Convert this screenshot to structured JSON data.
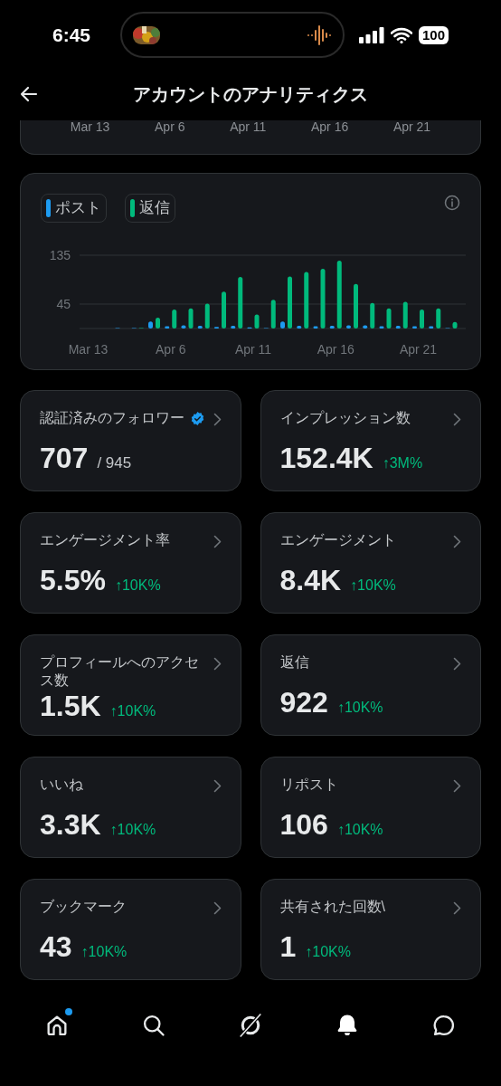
{
  "status_bar": {
    "time": "6:45",
    "battery": "100"
  },
  "header": {
    "title": "アカウントのアナリティクス"
  },
  "previous_chart": {
    "axis_labels": [
      "Mar 13",
      "Apr 6",
      "Apr 11",
      "Apr 16",
      "Apr 21"
    ]
  },
  "chart_card": {
    "chart_data": {
      "type": "bar",
      "categories": [
        "Mar 13",
        null,
        null,
        null,
        null,
        "Apr 6",
        null,
        null,
        null,
        null,
        "Apr 11",
        null,
        null,
        null,
        null,
        "Apr 16",
        null,
        null,
        null,
        null,
        "Apr 21",
        null,
        null
      ],
      "series": [
        {
          "name": "ポスト",
          "color": "#1d9bf0",
          "values": [
            null,
            null,
            1,
            1,
            13,
            4,
            6,
            5,
            3,
            5,
            2,
            1,
            13,
            5,
            4,
            5,
            6,
            6,
            4,
            5,
            4,
            4,
            1
          ]
        },
        {
          "name": "返信",
          "color": "#00ba7c",
          "values": [
            null,
            null,
            0,
            1,
            20,
            35,
            37,
            46,
            68,
            95,
            26,
            53,
            96,
            104,
            110,
            125,
            82,
            47,
            37,
            49,
            35,
            37,
            12
          ]
        }
      ],
      "ylim": [
        0,
        135
      ],
      "yticks": [
        45,
        135
      ]
    }
  },
  "metrics": [
    {
      "title": "認証済みのフォロワー",
      "verified": true,
      "value": "707",
      "kind": "total",
      "extra": "/ 945"
    },
    {
      "title": "インプレッション数",
      "verified": false,
      "value": "152.4K",
      "kind": "change",
      "extra": "↑3M%"
    },
    {
      "title": "エンゲージメント率",
      "verified": false,
      "value": "5.5%",
      "kind": "change",
      "extra": "↑10K%"
    },
    {
      "title": "エンゲージメント",
      "verified": false,
      "value": "8.4K",
      "kind": "change",
      "extra": "↑10K%"
    },
    {
      "title": "プロフィールへのアクセス数",
      "verified": false,
      "value": "1.5K",
      "kind": "change",
      "extra": "↑10K%"
    },
    {
      "title": "返信",
      "verified": false,
      "value": "922",
      "kind": "change",
      "extra": "↑10K%"
    },
    {
      "title": "いいね",
      "verified": false,
      "value": "3.3K",
      "kind": "change",
      "extra": "↑10K%"
    },
    {
      "title": "リポスト",
      "verified": false,
      "value": "106",
      "kind": "change",
      "extra": "↑10K%"
    },
    {
      "title": "ブックマーク",
      "verified": false,
      "value": "43",
      "kind": "change",
      "extra": "↑10K%"
    },
    {
      "title": "共有された回数\\",
      "verified": false,
      "value": "1",
      "kind": "change",
      "extra": "↑10K%"
    }
  ],
  "bottom_nav": [
    {
      "kind": "home",
      "selected": false,
      "badge": true
    },
    {
      "kind": "search",
      "selected": false,
      "badge": false
    },
    {
      "kind": "grok",
      "selected": false,
      "badge": false
    },
    {
      "kind": "notifications",
      "selected": true,
      "badge": false
    },
    {
      "kind": "messages",
      "selected": false,
      "badge": false
    }
  ]
}
